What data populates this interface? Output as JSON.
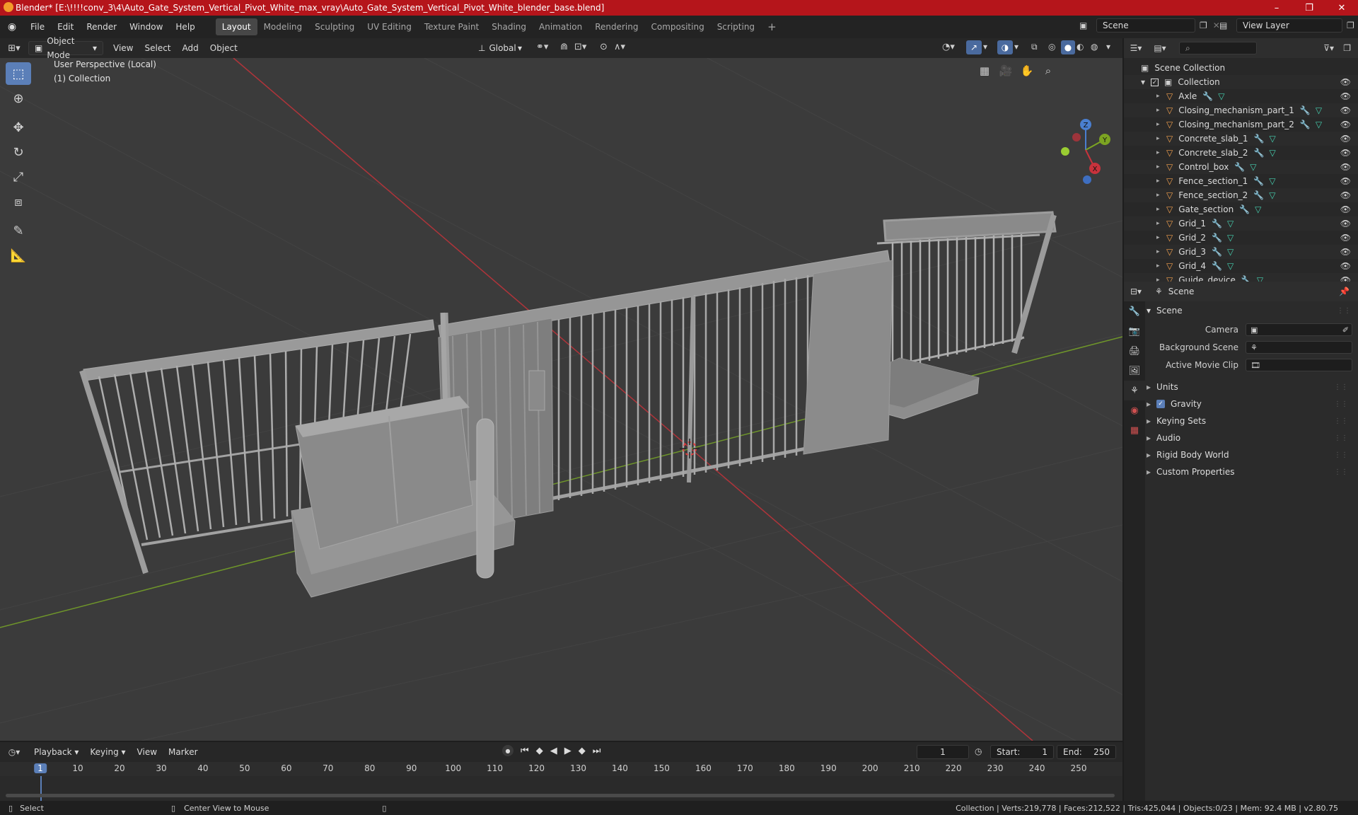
{
  "window": {
    "title": "Blender* [E:\\!!!!conv_3\\4\\Auto_Gate_System_Vertical_Pivot_White_max_vray\\Auto_Gate_System_Vertical_Pivot_White_blender_base.blend]",
    "minimize": "–",
    "maximize": "❐",
    "close": "✕"
  },
  "menu": [
    "File",
    "Edit",
    "Render",
    "Window",
    "Help"
  ],
  "workspaces": [
    "Layout",
    "Modeling",
    "Sculpting",
    "UV Editing",
    "Texture Paint",
    "Shading",
    "Animation",
    "Rendering",
    "Compositing",
    "Scripting"
  ],
  "workspace_add": "+",
  "scene_field": "Scene",
  "viewlayer_field": "View Layer",
  "viewport_header": {
    "mode": "Object Mode",
    "menus": [
      "View",
      "Select",
      "Add",
      "Object"
    ],
    "orientation": "Global"
  },
  "viewport": {
    "perspective": "User Perspective (Local)",
    "collection": "(1) Collection",
    "gizmo": {
      "x": "X",
      "y": "Y",
      "z": "Z"
    }
  },
  "outliner": {
    "root": "Scene Collection",
    "collection": "Collection",
    "items": [
      "Axle",
      "Closing_mechanism_part_1",
      "Closing_mechanism_part_2",
      "Concrete_slab_1",
      "Concrete_slab_2",
      "Control_box",
      "Fence_section_1",
      "Fence_section_2",
      "Gate_section",
      "Grid_1",
      "Grid_2",
      "Grid_3",
      "Grid_4",
      "Guide_device"
    ]
  },
  "properties": {
    "context": "Scene",
    "panel": "Scene",
    "camera_label": "Camera",
    "bgscene_label": "Background Scene",
    "movieclip_label": "Active Movie Clip",
    "subpanels": [
      "Units",
      "Gravity",
      "Keying Sets",
      "Audio",
      "Rigid Body World",
      "Custom Properties"
    ]
  },
  "timeline": {
    "menus": [
      "Playback",
      "Keying",
      "View",
      "Marker"
    ],
    "current_frame": "1",
    "start_label": "Start:",
    "start": "1",
    "end_label": "End:",
    "end": "250",
    "ticks": [
      "1",
      "10",
      "20",
      "30",
      "40",
      "50",
      "60",
      "70",
      "80",
      "90",
      "100",
      "110",
      "120",
      "130",
      "140",
      "150",
      "160",
      "170",
      "180",
      "190",
      "200",
      "210",
      "220",
      "230",
      "240",
      "250"
    ]
  },
  "status": {
    "select": "Select",
    "center": "Center View to Mouse",
    "stats": "Collection | Verts:219,778 | Faces:212,522 | Tris:425,044 | Objects:0/23 | Mem: 92.4 MB | v2.80.75"
  },
  "colors": {
    "titlebar": "#b5151b",
    "accent": "#5b7fb8",
    "axis_x": "#c8323c",
    "axis_y": "#7ca422",
    "axis_z": "#4a7fd0"
  }
}
